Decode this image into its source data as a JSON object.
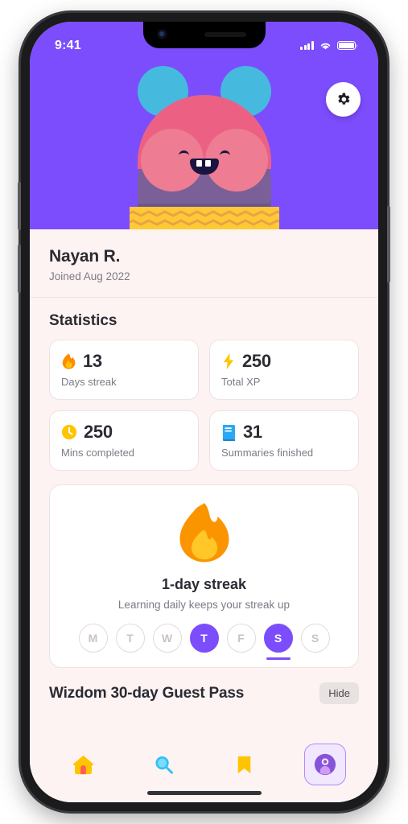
{
  "status_bar": {
    "time": "9:41",
    "signal_icon": "cellular-signal-icon",
    "wifi_icon": "wifi-icon",
    "battery_icon": "battery-full-icon"
  },
  "header": {
    "background_color": "#7C4DFC",
    "settings_button_label": "settings-gear",
    "avatar_alt": "cartoon-avatar-purple-bear"
  },
  "profile": {
    "name": "Nayan R.",
    "joined": "Joined Aug 2022"
  },
  "statistics": {
    "title": "Statistics",
    "cards": [
      {
        "icon": "fire-icon",
        "value": "13",
        "label": "Days streak",
        "color": "#FF8A00"
      },
      {
        "icon": "lightning-icon",
        "value": "250",
        "label": "Total XP",
        "color": "#FFC400"
      },
      {
        "icon": "clock-icon",
        "value": "250",
        "label": "Mins completed",
        "color": "#FFC400"
      },
      {
        "icon": "book-icon",
        "value": "31",
        "label": "Summaries finished",
        "color": "#29A9F4"
      }
    ]
  },
  "streak": {
    "icon": "large-flame-icon",
    "title": "1-day streak",
    "subtitle": "Learning daily keeps your streak up",
    "days": [
      {
        "label": "M",
        "active": false,
        "today": false
      },
      {
        "label": "T",
        "active": false,
        "today": false
      },
      {
        "label": "W",
        "active": false,
        "today": false
      },
      {
        "label": "T",
        "active": true,
        "today": false
      },
      {
        "label": "F",
        "active": false,
        "today": false
      },
      {
        "label": "S",
        "active": true,
        "today": true
      },
      {
        "label": "S",
        "active": false,
        "today": false
      }
    ],
    "accent_color": "#7C4DFC"
  },
  "guest_pass": {
    "title": "Wizdom 30-day Guest Pass",
    "hide_label": "Hide"
  },
  "tabbar": {
    "items": [
      {
        "icon": "home-icon",
        "active": false
      },
      {
        "icon": "search-icon",
        "active": false
      },
      {
        "icon": "bookmark-icon",
        "active": false
      },
      {
        "icon": "profile-icon",
        "active": true
      }
    ]
  },
  "colors": {
    "accent_purple": "#7C4DFC",
    "background": "#FDF3F3",
    "card": "#FFFFFF",
    "text_primary": "#2B2B33",
    "text_secondary": "#7E7A85"
  }
}
